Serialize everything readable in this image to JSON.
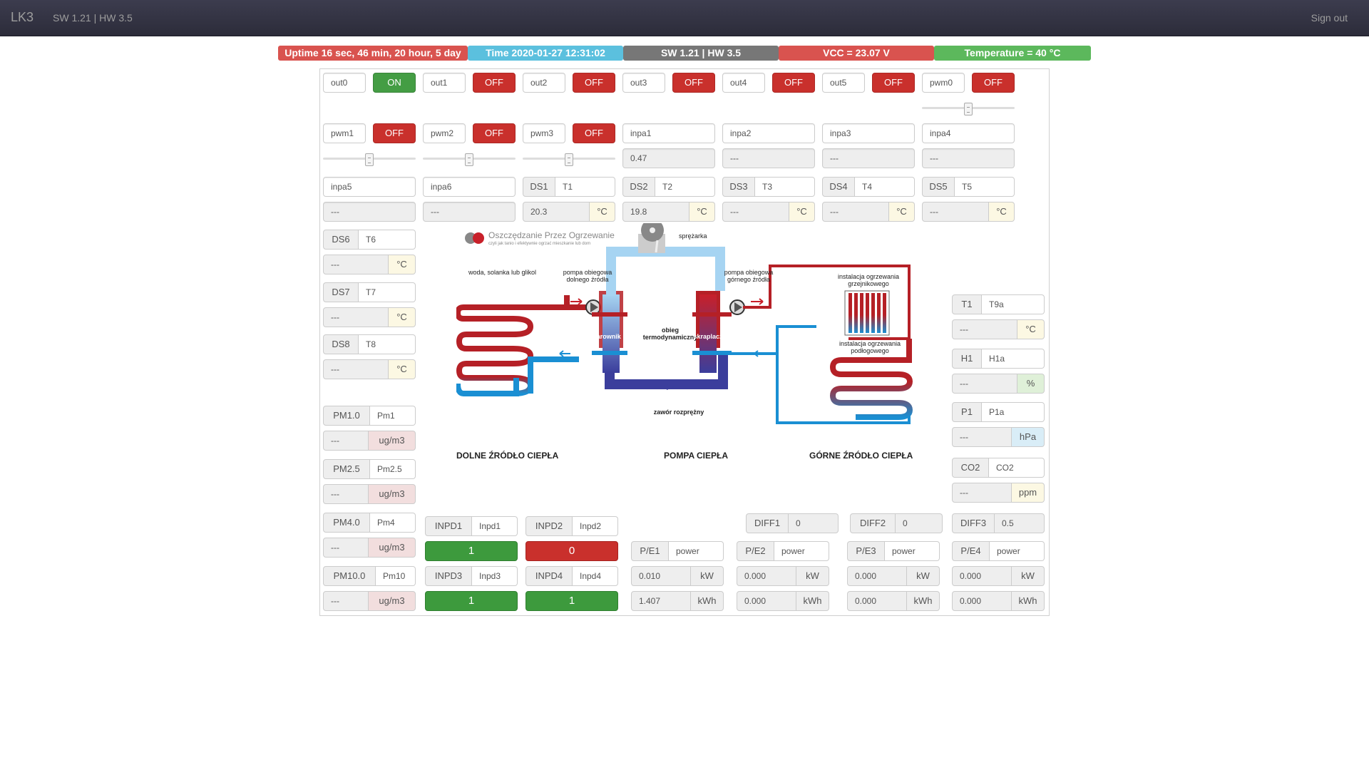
{
  "nav": {
    "brand": "LK3",
    "version": "SW 1.21 | HW 3.5",
    "signout": "Sign out"
  },
  "status": {
    "uptime": "Uptime 16 sec, 46 min, 20 hour, 5 day",
    "time": "Time 2020-01-27 12:31:02",
    "swhw": "SW 1.21 | HW 3.5",
    "vcc": "VCC = 23.07 V",
    "temperature": "Temperature = 40 °C",
    "colors": {
      "uptime": "#d9534f",
      "time": "#5bc0de",
      "swhw": "#777777",
      "vcc": "#d9534f",
      "temperature": "#5cb85c"
    }
  },
  "outputs": [
    {
      "name": "out0",
      "state": "ON"
    },
    {
      "name": "out1",
      "state": "OFF"
    },
    {
      "name": "out2",
      "state": "OFF"
    },
    {
      "name": "out3",
      "state": "OFF"
    },
    {
      "name": "out4",
      "state": "OFF"
    },
    {
      "name": "out5",
      "state": "OFF"
    },
    {
      "name": "pwm0",
      "state": "OFF"
    }
  ],
  "pwm": [
    {
      "name": "pwm1",
      "state": "OFF"
    },
    {
      "name": "pwm2",
      "state": "OFF"
    },
    {
      "name": "pwm3",
      "state": "OFF"
    }
  ],
  "inpa_top": [
    {
      "name": "inpa1",
      "value": "0.47"
    },
    {
      "name": "inpa2",
      "value": "---"
    },
    {
      "name": "inpa3",
      "value": "---"
    },
    {
      "name": "inpa4",
      "value": "---"
    }
  ],
  "inpa_row": [
    {
      "name": "inpa5",
      "value": "---"
    },
    {
      "name": "inpa6",
      "value": "---"
    }
  ],
  "ds_row": [
    {
      "id": "DS1",
      "name": "T1",
      "value": "20.3",
      "unit": "°C"
    },
    {
      "id": "DS2",
      "name": "T2",
      "value": "19.8",
      "unit": "°C"
    },
    {
      "id": "DS3",
      "name": "T3",
      "value": "---",
      "unit": "°C"
    },
    {
      "id": "DS4",
      "name": "T4",
      "value": "---",
      "unit": "°C"
    },
    {
      "id": "DS5",
      "name": "T5",
      "value": "---",
      "unit": "°C"
    }
  ],
  "ds_left": [
    {
      "id": "DS6",
      "name": "T6",
      "value": "---",
      "unit": "°C"
    },
    {
      "id": "DS7",
      "name": "T7",
      "value": "---",
      "unit": "°C"
    },
    {
      "id": "DS8",
      "name": "T8",
      "value": "---",
      "unit": "°C"
    }
  ],
  "pm": [
    {
      "id": "PM1.0",
      "name": "Pm1",
      "value": "---",
      "unit": "ug/m3"
    },
    {
      "id": "PM2.5",
      "name": "Pm2.5",
      "value": "---",
      "unit": "ug/m3"
    },
    {
      "id": "PM4.0",
      "name": "Pm4",
      "value": "---",
      "unit": "ug/m3"
    },
    {
      "id": "PM10.0",
      "name": "Pm10",
      "value": "---",
      "unit": "ug/m3"
    }
  ],
  "right_sensors": [
    {
      "id": "T1",
      "name": "T9a",
      "value": "---",
      "unit": "°C"
    },
    {
      "id": "H1",
      "name": "H1a",
      "value": "---",
      "unit": "%"
    },
    {
      "id": "P1",
      "name": "P1a",
      "value": "---",
      "unit": "hPa"
    },
    {
      "id": "CO2",
      "name": "CO2",
      "value": "---",
      "unit": "ppm"
    }
  ],
  "inpd": [
    {
      "id": "INPD1",
      "name": "Inpd1",
      "value": "1"
    },
    {
      "id": "INPD2",
      "name": "Inpd2",
      "value": "0"
    },
    {
      "id": "INPD3",
      "name": "Inpd3",
      "value": "1"
    },
    {
      "id": "INPD4",
      "name": "Inpd4",
      "value": "1"
    }
  ],
  "diff": [
    {
      "id": "DIFF1",
      "value": "0"
    },
    {
      "id": "DIFF2",
      "value": "0"
    },
    {
      "id": "DIFF3",
      "value": "0.5"
    }
  ],
  "power": [
    {
      "id": "P/E1",
      "name": "power",
      "kw": "0.010",
      "kwh": "1.407"
    },
    {
      "id": "P/E2",
      "name": "power",
      "kw": "0.000",
      "kwh": "0.000"
    },
    {
      "id": "P/E3",
      "name": "power",
      "kw": "0.000",
      "kwh": "0.000"
    },
    {
      "id": "P/E4",
      "name": "power",
      "kw": "0.000",
      "kwh": "0.000"
    }
  ],
  "units": {
    "kw": "kW",
    "kwh": "kWh"
  },
  "diagram": {
    "logo": "Oszczędzanie Przez Ogrzewanie",
    "logo_sub": "czyli jak tanio i efektywnie ogrzać mieszkanie lub dom",
    "left_label": "woda, solanka lub glikol",
    "pump_low": "pompa obiegowa dolnego źródła",
    "compressor": "sprężarka",
    "pump_high": "pompa obiegowa górnego źródła",
    "radiator": "instalacja ogrzewania grzejnikowego",
    "floor": "instalacja ogrzewania podłogowego",
    "evaporator": "parownik",
    "cycle": "obieg termodynamiczny",
    "condenser": "skraplacz",
    "valve": "zawór rozprężny",
    "title_low": "DOLNE ŹRÓDŁO CIEPŁA",
    "title_pump": "POMPA CIEPŁA",
    "title_high": "GÓRNE ŹRÓDŁO CIEPŁA"
  }
}
